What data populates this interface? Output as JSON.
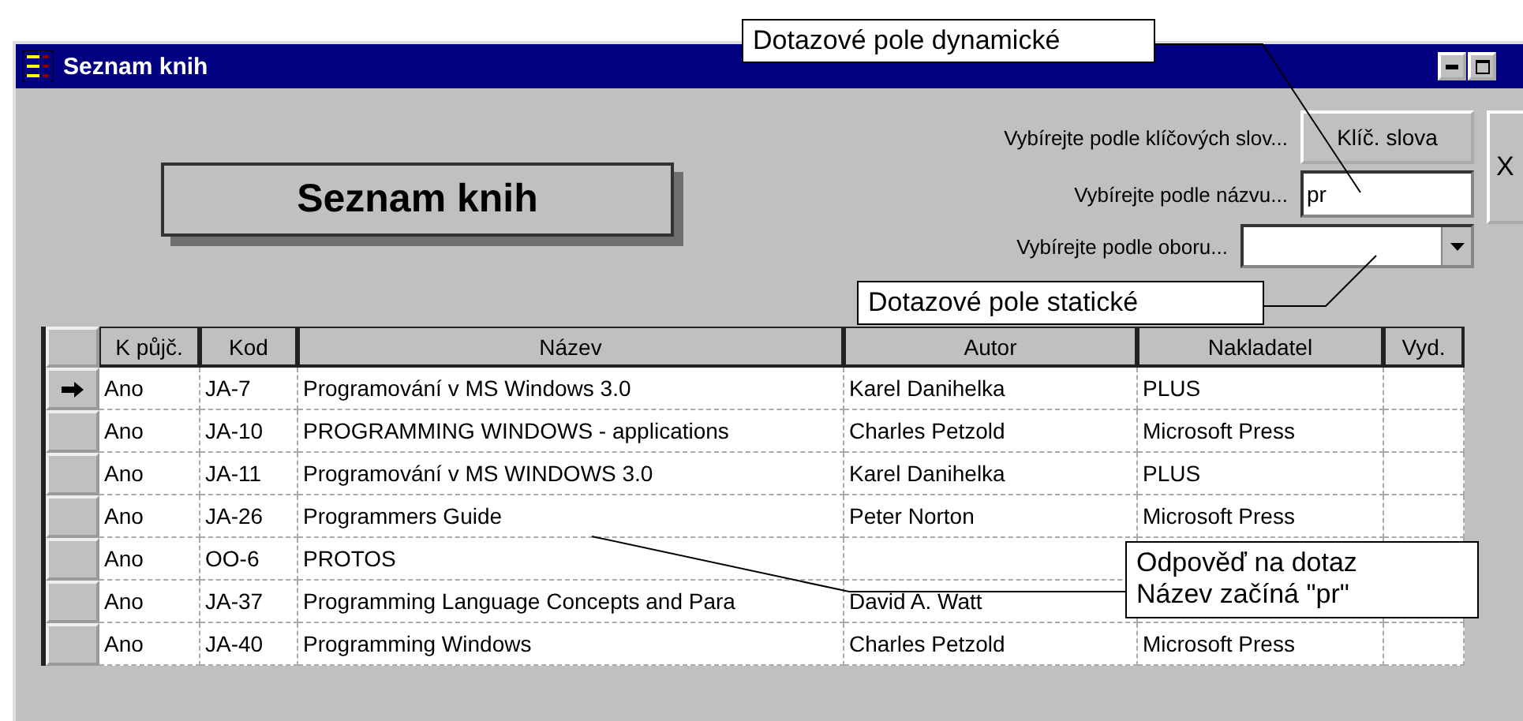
{
  "window": {
    "title": "Seznam knih"
  },
  "form_title": "Seznam knih",
  "filters": [
    {
      "kind": "button",
      "label": "Vybírejte podle klíčových slov...",
      "button": "Klíč. slova"
    },
    {
      "kind": "text",
      "label": "Vybírejte podle názvu...",
      "value": "pr"
    },
    {
      "kind": "dropdown",
      "label": "Vybírejte podle oboru..."
    }
  ],
  "side_button": {
    "label": "X"
  },
  "table": {
    "columns": [
      "K půjč.",
      "Kod",
      "Název",
      "Autor",
      "Nakladatel",
      "Vyd."
    ],
    "rows": [
      {
        "selected": true,
        "cells": [
          "Ano",
          "JA-7",
          "Programování v MS Windows 3.0",
          "Karel Danihelka",
          "PLUS"
        ]
      },
      {
        "selected": false,
        "cells": [
          "Ano",
          "JA-10",
          "PROGRAMMING WINDOWS - applications",
          "Charles Petzold",
          "Microsoft Press"
        ]
      },
      {
        "selected": false,
        "cells": [
          "Ano",
          "JA-11",
          "Programování v MS WINDOWS 3.0",
          "Karel Danihelka",
          "PLUS"
        ]
      },
      {
        "selected": false,
        "cells": [
          "Ano",
          "JA-26",
          "Programmers Guide",
          "Peter Norton",
          "Microsoft Press"
        ]
      },
      {
        "selected": false,
        "cells": [
          "Ano",
          "OO-6",
          "PROTOS"
        ]
      },
      {
        "selected": false,
        "cells": [
          "Ano",
          "JA-37",
          "Programming Language Concepts and Para",
          "David A. Watt"
        ]
      },
      {
        "selected": false,
        "cells": [
          "Ano",
          "JA-40",
          "Programming Windows",
          "Charles Petzold",
          "Microsoft Press"
        ]
      }
    ]
  },
  "callouts": [
    {
      "text": "Dotazové pole dynamické"
    },
    {
      "text": "Dotazové pole statické"
    },
    {
      "text": "Odpověď na dotaz\nNázev začíná \"pr\""
    }
  ]
}
